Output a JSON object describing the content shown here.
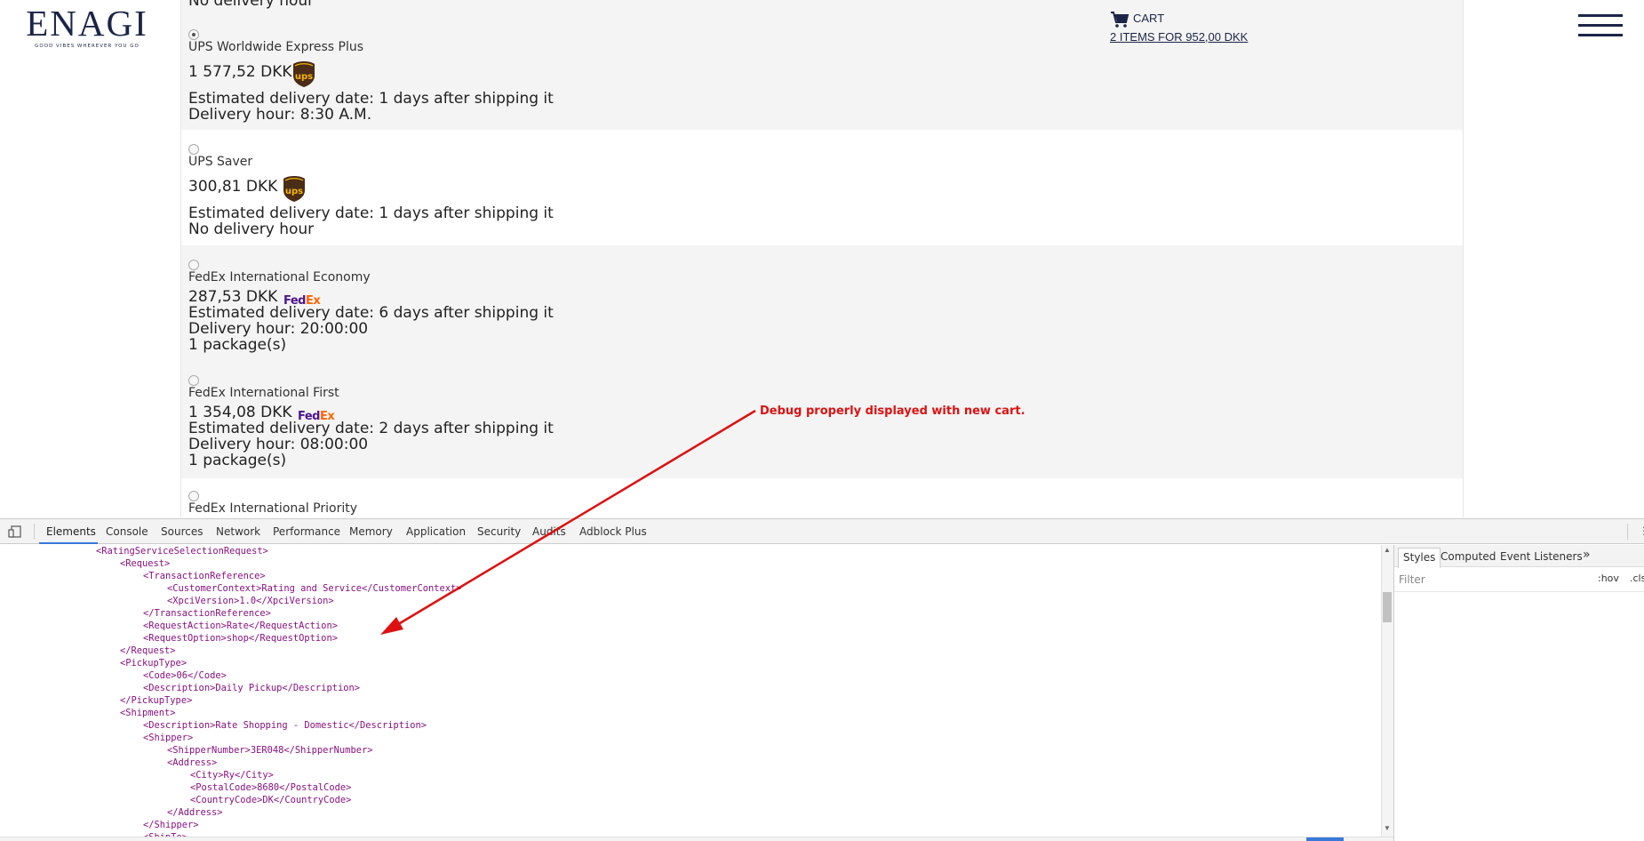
{
  "site": {
    "logo_word": "ENAGI",
    "logo_tagline": "GOOD VIBES WHEREVER YOU GO",
    "cart": {
      "title": "CART",
      "summary": "2 ITEMS FOR 952,00 DKK",
      "icon": "shopping-cart-icon"
    },
    "menu_icon": "hamburger-menu-icon",
    "top_partial": "No delivery hour",
    "shipping_options": [
      {
        "name": "UPS Worldwide Express Plus",
        "price": "1 577,52 DKK",
        "carrier": "UPS",
        "selected": true,
        "lines": [
          "Estimated delivery date: 1 days after shipping it",
          "Delivery hour: 8:30 A.M."
        ]
      },
      {
        "name": "UPS Saver",
        "price": "300,81 DKK",
        "carrier": "UPS",
        "selected": false,
        "lines": [
          "Estimated delivery date: 1 days after shipping it",
          "No delivery hour"
        ]
      },
      {
        "name": "FedEx International Economy",
        "price": "287,53 DKK",
        "carrier": "FedEx",
        "selected": false,
        "lines": [
          "Estimated delivery date: 6 days after shipping it",
          "Delivery hour: 20:00:00",
          "1 package(s)"
        ]
      },
      {
        "name": "FedEx International First",
        "price": "1 354,08 DKK",
        "carrier": "FedEx",
        "selected": false,
        "lines": [
          "Estimated delivery date: 2 days after shipping it",
          "Delivery hour: 08:00:00",
          "1 package(s)"
        ]
      },
      {
        "name": "FedEx International Priority",
        "carrier": "FedEx",
        "selected": false
      }
    ],
    "fedex_logo": {
      "fe": "Fed",
      "ex": "Ex"
    },
    "ups_logo_text": "ups"
  },
  "annotation": {
    "text": "Debug properly displayed with new cart.",
    "color": "#dd1111"
  },
  "devtools": {
    "tabs": [
      "Elements",
      "Console",
      "Sources",
      "Network",
      "Performance",
      "Memory",
      "Application",
      "Security",
      "Audits",
      "Adblock Plus"
    ],
    "active_tab": "Elements",
    "right_glyph": "⋮",
    "code_lines": [
      "<RatingServiceSelectionRequest>",
      "<Request>",
      "<TransactionReference>",
      "<CustomerContext>Rating and Service</CustomerContext>",
      "<XpciVersion>1.0</XpciVersion>",
      "</TransactionReference>",
      "<RequestAction>Rate</RequestAction>",
      "<RequestOption>shop</RequestOption>",
      "</Request>",
      "<PickupType>",
      "<Code>06</Code>",
      "<Description>Daily Pickup</Description>",
      "</PickupType>",
      "<Shipment>",
      "<Description>Rate Shopping - Domestic</Description>",
      "<Shipper>",
      "<ShipperNumber>3ER048</ShipperNumber>",
      "<Address>",
      "<City>Ry</City>",
      "<PostalCode>8680</PostalCode>",
      "<CountryCode>DK</CountryCode>",
      "</Address>",
      "</Shipper>",
      "<ShipTo>"
    ],
    "styles_pane": {
      "tabs": [
        "Styles",
        "Computed",
        "Event Listeners"
      ],
      "active_tab": "Styles",
      "more": "»",
      "filter_placeholder": "Filter",
      "hov": ":hov",
      "cls": ".cls"
    }
  },
  "colors": {
    "brand": "#1c2548",
    "xml_tag": "#881280",
    "devtools_accent": "#3879d9",
    "fedex_purple": "#4d148c",
    "fedex_orange": "#ff6600",
    "ups_brown": "#4a2c17",
    "ups_gold": "#f5b500"
  }
}
